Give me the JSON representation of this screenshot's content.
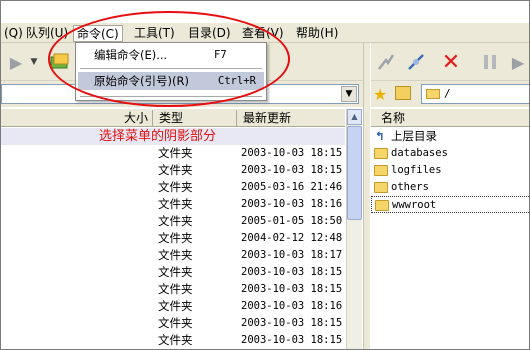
{
  "menubar": {
    "items": [
      "(Q)",
      "队列(U)",
      "命令(C)",
      "工具(T)",
      "目录(D)",
      "查看(V)",
      "帮助(H)"
    ],
    "active_index": 2
  },
  "dropdown": {
    "items": [
      {
        "label": "编辑命令(E)...",
        "shortcut": "F7"
      },
      {
        "label": "原始命令(引号)(R)",
        "shortcut": "Ctrl+R"
      }
    ]
  },
  "toolbar_right": {
    "icons": [
      "disconnect-icon",
      "reconnect-icon",
      "delete-icon",
      "pause-icon",
      "queue-icon"
    ]
  },
  "right_address": {
    "value": "/"
  },
  "left_list": {
    "headers": [
      "大小",
      "类型",
      "最新更新"
    ],
    "annotation": "选择菜单的阴影部分",
    "rows": [
      {
        "type": "文件夹",
        "date": "2003-10-03 18:15"
      },
      {
        "type": "文件夹",
        "date": "2003-10-03 18:15"
      },
      {
        "type": "文件夹",
        "date": "2005-03-16 21:46"
      },
      {
        "type": "文件夹",
        "date": "2003-10-03 18:16"
      },
      {
        "type": "文件夹",
        "date": "2005-01-05 18:50"
      },
      {
        "type": "文件夹",
        "date": "2004-02-12 12:48"
      },
      {
        "type": "文件夹",
        "date": "2003-10-03 18:17"
      },
      {
        "type": "文件夹",
        "date": "2003-10-03 18:15"
      },
      {
        "type": "文件夹",
        "date": "2003-10-03 18:15"
      },
      {
        "type": "文件夹",
        "date": "2003-10-03 18:16"
      },
      {
        "type": "文件夹",
        "date": "2003-10-03 18:15"
      },
      {
        "type": "文件夹",
        "date": "2003-10-03 18:15"
      }
    ]
  },
  "right_list": {
    "header": "名称",
    "parent": "上层目录",
    "folders": [
      "databases",
      "logfiles",
      "others",
      "wwwroot"
    ]
  },
  "colors": {
    "annotation": "#e60e0e",
    "menu_highlight": "#c1c9da"
  }
}
